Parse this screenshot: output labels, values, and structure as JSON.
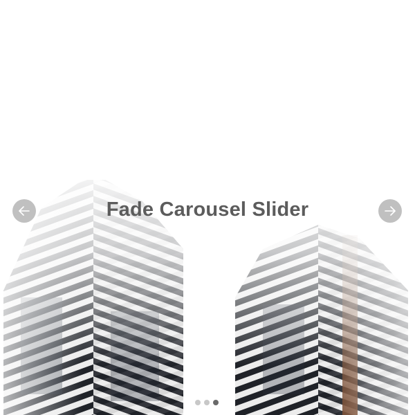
{
  "slider": {
    "title": "Fade Carousel Slider",
    "prev_icon": "arrow-left-icon",
    "next_icon": "arrow-right-icon",
    "dots": [
      {
        "index": 1,
        "active": false
      },
      {
        "index": 2,
        "active": false
      },
      {
        "index": 3,
        "active": true
      }
    ],
    "colors": {
      "title": "#5c5c5c",
      "arrow_bg": "#8c8c8c",
      "dot": "#c8c8c8",
      "dot_active": "#6a6a6a"
    }
  }
}
